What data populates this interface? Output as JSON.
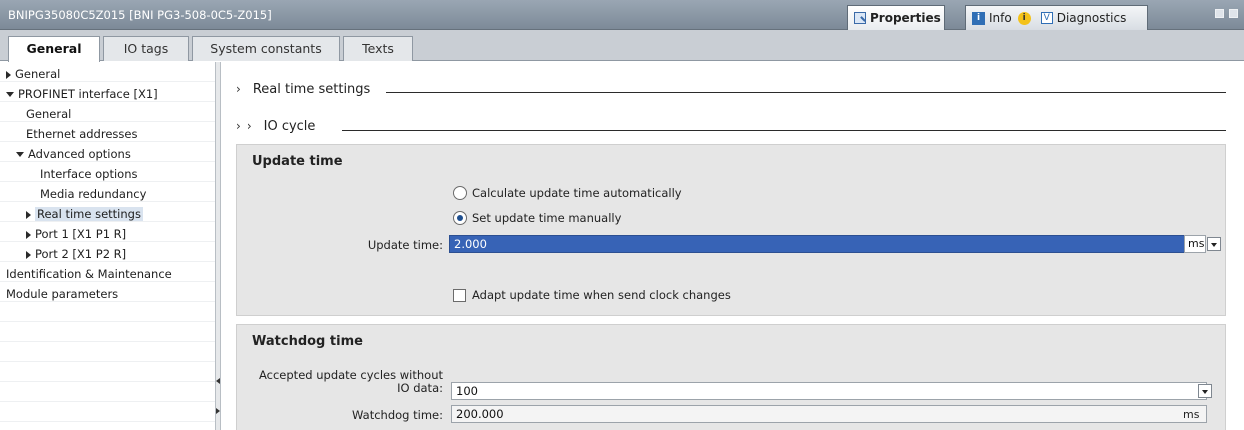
{
  "window": {
    "title": "BNIPG35080C5Z015 [BNI PG3-508-0C5-Z015]",
    "panel_tabs": [
      {
        "label": "Properties",
        "icon": "properties-icon",
        "active": true
      },
      {
        "label": "Info",
        "icon": "info-icon",
        "badge_icon": "info-badge-icon",
        "active": false
      },
      {
        "label": "Diagnostics",
        "icon": "diagnostics-icon",
        "active": false
      }
    ]
  },
  "tabs": [
    {
      "label": "General",
      "active": true
    },
    {
      "label": "IO tags",
      "active": false
    },
    {
      "label": "System constants",
      "active": false
    },
    {
      "label": "Texts",
      "active": false
    }
  ],
  "tree": [
    {
      "label": "General",
      "indent": 0,
      "expander": "right"
    },
    {
      "label": "PROFINET interface [X1]",
      "indent": 0,
      "expander": "down"
    },
    {
      "label": "General",
      "indent": 2,
      "expander": ""
    },
    {
      "label": "Ethernet addresses",
      "indent": 2,
      "expander": ""
    },
    {
      "label": "Advanced options",
      "indent": 1,
      "expander": "down"
    },
    {
      "label": "Interface options",
      "indent": 3,
      "expander": ""
    },
    {
      "label": "Media redundancy",
      "indent": 3,
      "expander": ""
    },
    {
      "label": "Real time settings",
      "indent": 2,
      "expander": "right",
      "selected": true
    },
    {
      "label": "Port 1 [X1 P1 R]",
      "indent": 2,
      "expander": "right"
    },
    {
      "label": "Port 2 [X1 P2 R]",
      "indent": 2,
      "expander": "right"
    },
    {
      "label": "Identification & Maintenance",
      "indent": 0,
      "expander": ""
    },
    {
      "label": "Module parameters",
      "indent": 0,
      "expander": ""
    }
  ],
  "main": {
    "realtime_heading": "Real time settings",
    "iocycle_heading": "IO cycle",
    "update_time": {
      "title": "Update time",
      "radio_auto": "Calculate update time automatically",
      "radio_manual": "Set update time manually",
      "selected": "manual",
      "field_label": "Update time:",
      "field_value": "2.000",
      "unit": "ms",
      "adapt_checkbox": "Adapt update time when send clock changes"
    },
    "watchdog": {
      "title": "Watchdog time",
      "cycles_label_line1": "Accepted update cycles without",
      "cycles_label_line2": "IO data:",
      "cycles_value": "100",
      "watchdog_label": "Watchdog time:",
      "watchdog_value": "200.000",
      "watchdog_unit": "ms"
    }
  }
}
